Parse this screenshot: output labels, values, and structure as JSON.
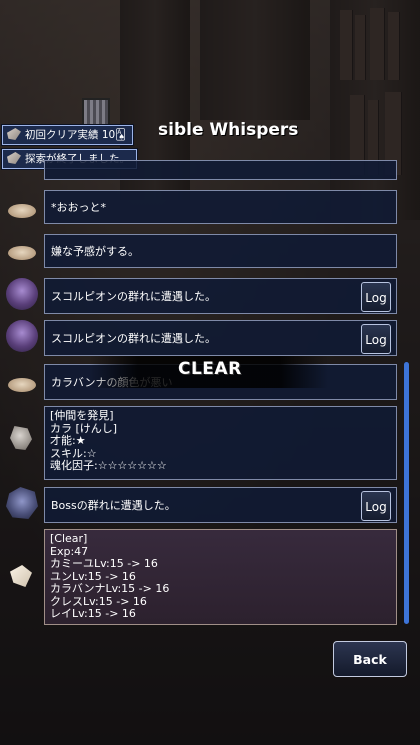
{
  "header": {
    "title": "sible Whispers"
  },
  "toasts": [
    {
      "text": "初回クリア実績 10🂡"
    },
    {
      "text": "探索が終了しました。"
    }
  ],
  "feed": {
    "messages": [
      {
        "icon": "plate-icon",
        "text": "*おおっと*"
      },
      {
        "icon": "plate-icon",
        "text": "嫌な予感がする。"
      },
      {
        "icon": "scorpion-icon",
        "text": "スコルピオンの群れに遭遇した。",
        "button": "Log"
      },
      {
        "icon": "scorpion-icon",
        "text": "スコルピオンの群れに遭遇した。",
        "button": "Log"
      },
      {
        "icon": "plate-icon",
        "text": "カラバンナの顔色が悪い"
      },
      {
        "icon": "rock-icon",
        "lines": [
          "[仲間を発見]",
          "カラ [けんし]",
          "才能:★",
          "スキル:☆",
          "魂化因子:☆☆☆☆☆☆☆"
        ]
      },
      {
        "icon": "boss-icon",
        "text": "Bossの群れに遭遇した。",
        "button": "Log"
      }
    ],
    "result": {
      "icon": "paper-icon",
      "lines": [
        "[Clear]",
        "Exp:47",
        "カミーユLv:15 -> 16",
        "ユンLv:15 -> 16",
        "カラバンナLv:15 -> 16",
        "クレスLv:15 -> 16",
        "レイLv:15 -> 16"
      ]
    }
  },
  "overlay": {
    "clear_text": "CLEAR"
  },
  "footer": {
    "back_label": "Back"
  },
  "colors": {
    "card_bg": "#101a34",
    "accent": "#3d74d8",
    "result_bg": "#3a2c40"
  }
}
